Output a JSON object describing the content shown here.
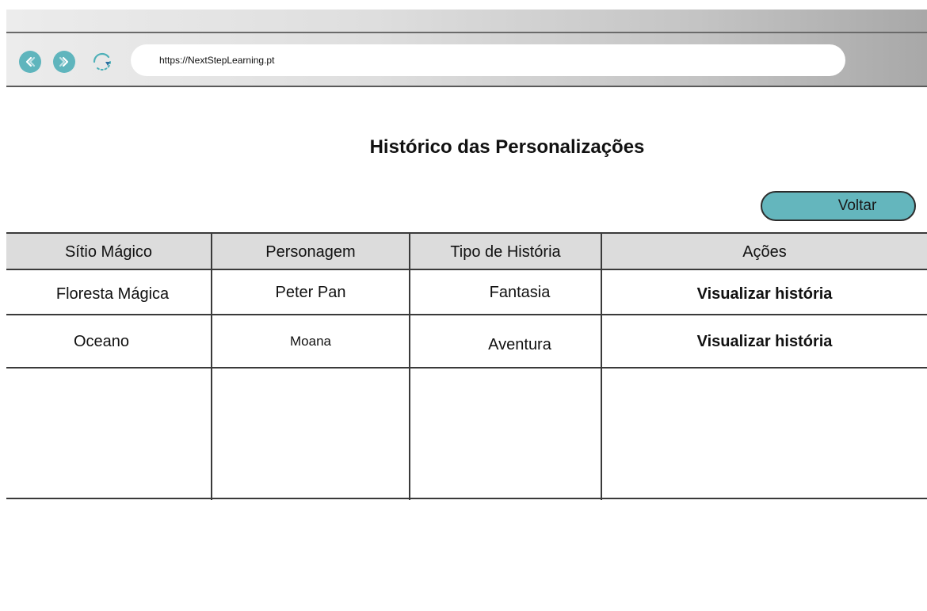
{
  "browser": {
    "url": "https://NextStepLearning.pt",
    "back_icon": "back-arrow-icon",
    "forward_icon": "forward-arrow-icon",
    "reload_icon": "reload-icon",
    "accent_color": "#5fb5bd"
  },
  "page": {
    "title": "Histórico das Personalizações",
    "back_button_label": "Voltar"
  },
  "table": {
    "columns": [
      "Sítio Mágico",
      "Personagem",
      "Tipo de História",
      "Ações"
    ],
    "rows": [
      {
        "sitio": "Floresta Mágica",
        "personagem": "Peter Pan",
        "tipo": "Fantasia",
        "acao": "Visualizar história"
      },
      {
        "sitio": "Oceano",
        "personagem": "Moana",
        "tipo": "Aventura",
        "acao": "Visualizar história"
      }
    ]
  }
}
